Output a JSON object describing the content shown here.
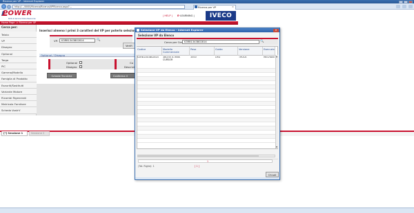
{
  "browser": {
    "title": "Ricerca per VP - Internet Explorer",
    "url": "http://.../0000/Ricerca/Ricerca/VPRicerca.aspx?...",
    "tab_label": "Ricerca per VP",
    "tab_close": "×"
  },
  "header": {
    "logo_text": "POWER",
    "logo_subtitle": "Parts & Service Online Resources",
    "help_label": "| HELP |",
    "elearning_prefix": "E-",
    "elearning_rest": "LEARNING |",
    "brand": "IVECO",
    "breadcrumb": "Home Page -> Ricerca per VP"
  },
  "left_menu": {
    "heading": "Cerca per:",
    "items": [
      "Telaio",
      "VP",
      "Disegno",
      "Optional",
      "Targa",
      "PIC",
      "Gamma/Modello",
      "Famiglia di Prodotto",
      "Esauriti/Sostituiti",
      "Variante Motore",
      "Ricambi Rigenerati",
      "Matricola Fornitore",
      "Scheda VostrV"
    ]
  },
  "main": {
    "instruction": "Inserisci almeno i primi 3 caratteri del VP per poterlo seleziona",
    "vp_label": "VP:",
    "vp_value": "K3RB1343B02814",
    "verify_button": "Verifi",
    "options_bar": "Optional / Disegno",
    "optional_label": "Optional",
    "disegno_label": "Disegno",
    "side_label_co": "Co",
    "side_label_descr": "Descrizi",
    "schede_button": "Schede Tecniche",
    "conferma_button": "Conferma V"
  },
  "sessions": {
    "tab1": "[*] Sessione 1",
    "tab2": "Sessione 2"
  },
  "popup": {
    "title": "Selezione VP da Elenco - Internet Explorer",
    "close": "✕",
    "heading": "Selezione VP da Elenco",
    "search_label": "Cerca per Codice:",
    "search_value": "K3RB1343B02814",
    "columns": [
      "Codice",
      "Modello Commerciale",
      "Peso",
      "Guida",
      "Versione",
      "Esecuzio"
    ],
    "rows": [
      [
        "K3RB1343B02814",
        "380/35 X-TRAK CURSOR",
        "3500",
        "LHD",
        "TRUCK",
        "MECHANI"
      ]
    ],
    "pager_marker": "1",
    "pager_label": "(Tot. Righe): 1",
    "pager_links": "[ 1 ]",
    "close_button": "Chiudi"
  },
  "colors": {
    "brand_red": "#c8102e",
    "brand_blue": "#1b3a88",
    "ie_blue": "#2b62ac"
  }
}
